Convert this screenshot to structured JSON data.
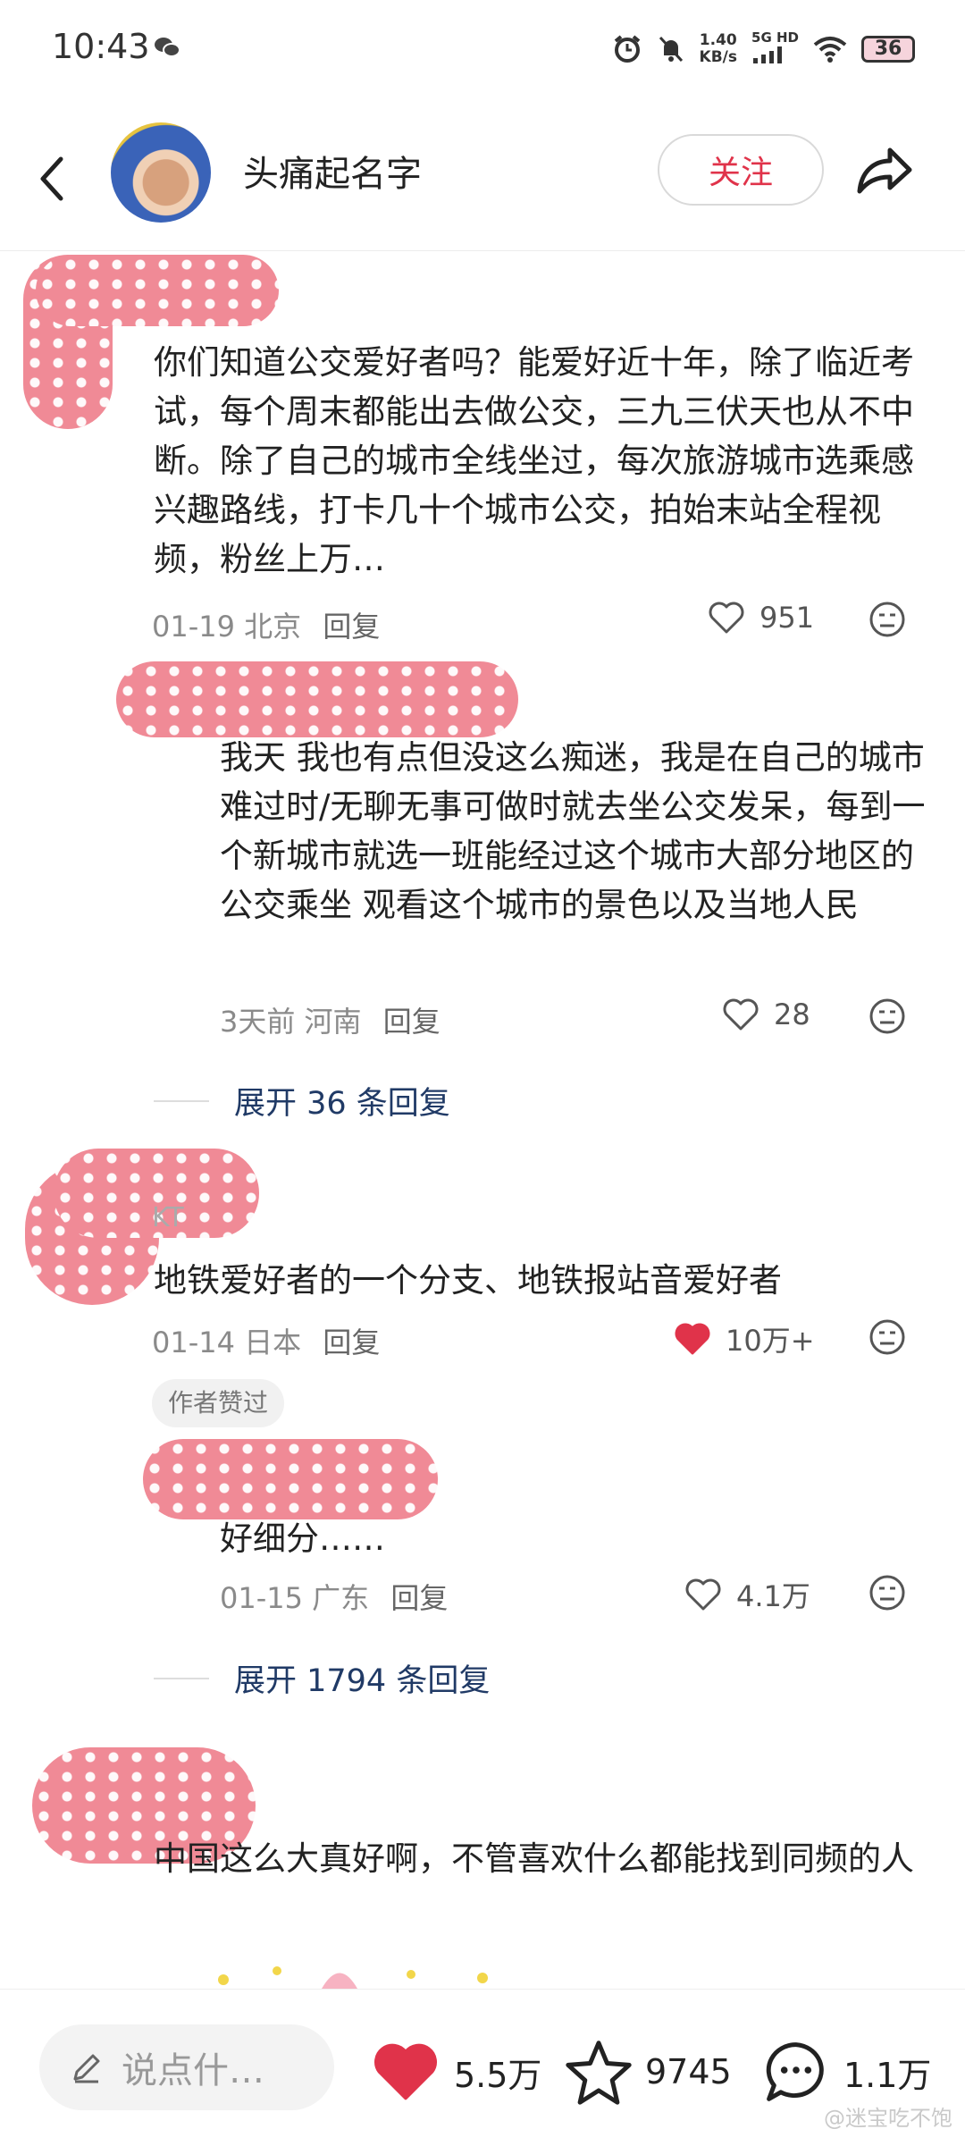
{
  "status_bar": {
    "time": "10:43",
    "speed_value": "1.40",
    "speed_unit": "KB/s",
    "net_top": "5G HD",
    "net_bottom": "",
    "battery": "36"
  },
  "header": {
    "author_name": "头痛起名字",
    "follow_label": "关注"
  },
  "comments": [
    {
      "text": "你们知道公交爱好者吗？能爱好近十年，除了临近考试，每个周末都能出去做公交，三九三伏天也从不中断。除了自己的城市全线坐过，每次旅游城市选乘感兴趣路线，打卡几十个城市公交，拍始末站全程视频，粉丝上万…",
      "date_loc": "01-19 北京",
      "reply": "回复",
      "likes": "951",
      "liked": false,
      "replies": [
        {
          "text": "我天 我也有点但没这么痴迷，我是在自己的城市难过时/无聊无事可做时就去坐公交发呆，每到一个新城市就选一班能经过这个城市大部分地区的公交乘坐 观看这个城市的景色以及当地人民",
          "date_loc": "3天前 河南",
          "reply": "回复",
          "likes": "28"
        }
      ],
      "expand": "展开 36 条回复"
    },
    {
      "name_partial": "KT",
      "text": "地铁爱好者的一个分支、地铁报站音爱好者",
      "date_loc": "01-14 日本",
      "reply": "回复",
      "likes": "10万+",
      "liked": true,
      "badge": "作者赞过",
      "replies": [
        {
          "text": "好细分……",
          "date_loc": "01-15 广东",
          "reply": "回复",
          "likes": "4.1万"
        }
      ],
      "expand": "展开 1794 条回复"
    },
    {
      "text": "中国这么大真好啊，不管喜欢什么都能找到同频的人"
    }
  ],
  "bottom_bar": {
    "input_placeholder": "说点什…",
    "likes": "5.5万",
    "favorites": "9745",
    "comments": "1.1万"
  },
  "watermark": "@迷宝吃不饱",
  "colors": {
    "accent_red": "#e0334a",
    "link_blue": "#203a66",
    "blur_pink": "#f08a96"
  }
}
